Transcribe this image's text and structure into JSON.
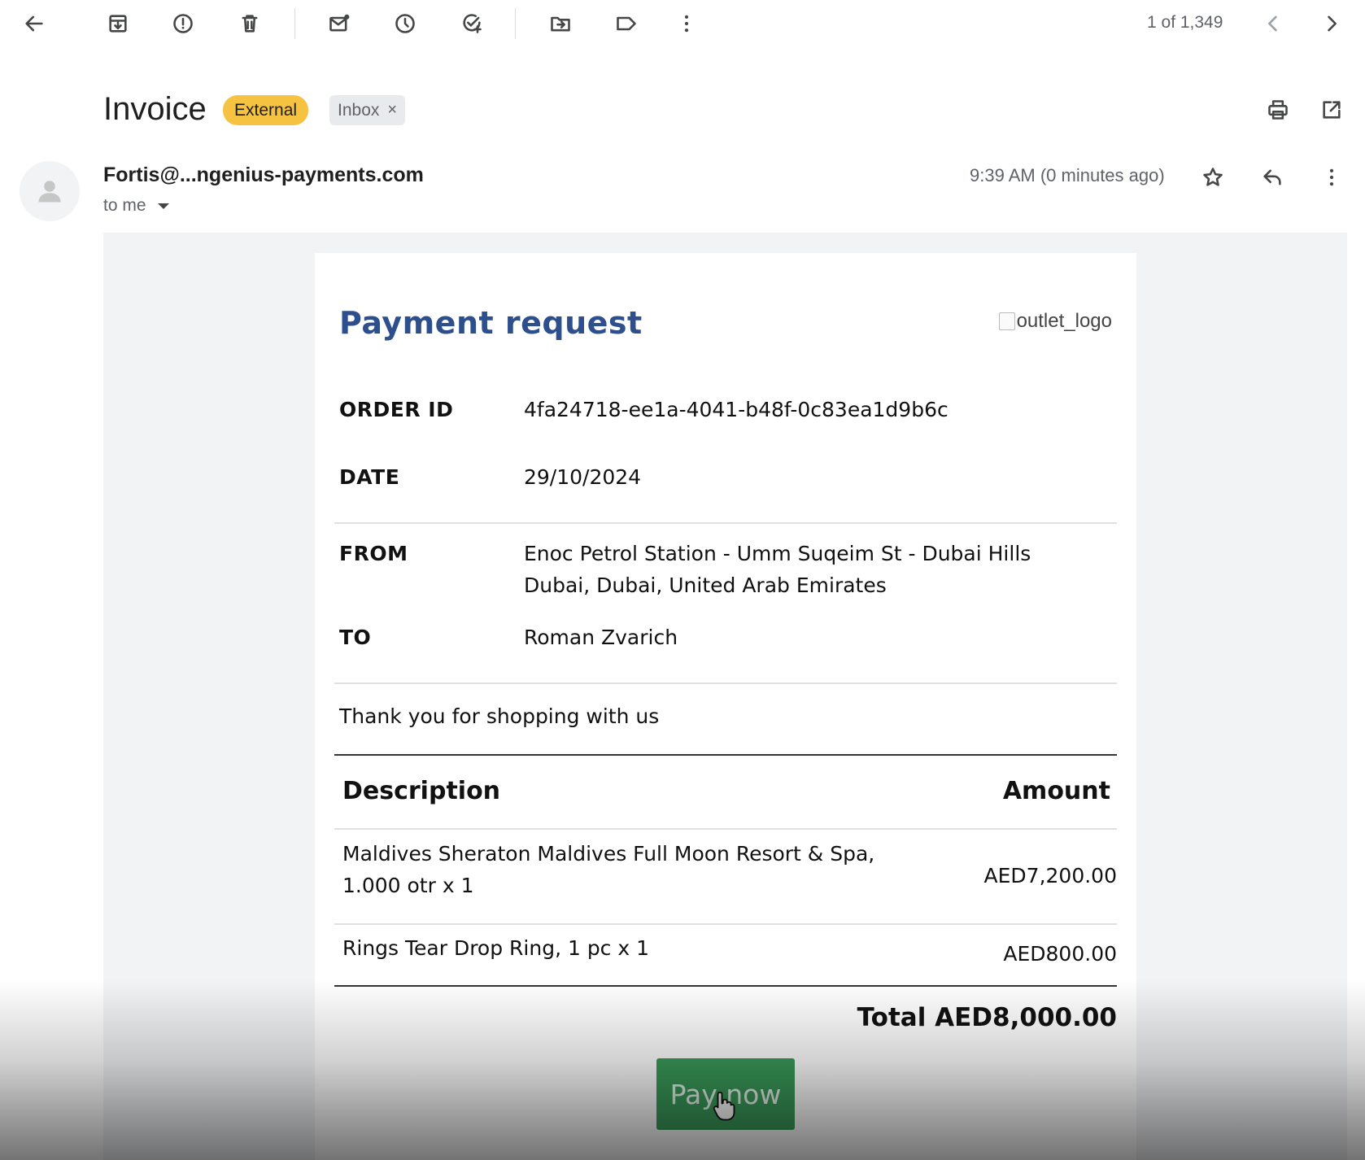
{
  "toolbar": {
    "icons": [
      "back-arrow-icon",
      "archive-icon",
      "report-spam-icon",
      "delete-icon",
      "mark-unread-icon",
      "snooze-icon",
      "add-task-icon",
      "move-to-icon",
      "label-icon",
      "more-vert-icon"
    ],
    "pager_text": "1 of 1,349"
  },
  "email": {
    "subject": "Invoice",
    "labels": {
      "external": "External",
      "inbox": "Inbox",
      "inbox_remove": "×"
    },
    "sender": "Fortis@...ngenius-payments.com",
    "recipient": "to me",
    "timestamp": "9:39 AM (0 minutes ago)"
  },
  "invoice": {
    "title": "Payment request",
    "logo_alt": "outlet_logo",
    "order_id_label": "ORDER ID",
    "order_id": "4fa24718-ee1a-4041-b48f-0c83ea1d9b6c",
    "date_label": "DATE",
    "date": "29/10/2024",
    "from_label": "FROM",
    "from_line1": "Enoc Petrol Station - Umm Suqeim St - Dubai Hills",
    "from_line2": "Dubai, Dubai, United Arab Emirates",
    "to_label": "TO",
    "to": "Roman Zvarich",
    "thank_you": "Thank you for shopping with us",
    "table": {
      "header_description": "Description",
      "header_amount": "Amount",
      "rows": [
        {
          "description_line1": "Maldives Sheraton Maldives Full Moon Resort & Spa,",
          "description_line2": "1.000 otr x 1",
          "amount": "AED7,200.00"
        },
        {
          "description_line1": "Rings Tear Drop Ring, 1 pc x 1",
          "amount": "AED800.00"
        }
      ]
    },
    "total": "Total AED8,000.00",
    "pay_button": "Pay now"
  },
  "colors": {
    "title_blue": "#2d4f8e",
    "external_chip": "#f5c242",
    "pay_green": "#3a9b5a"
  }
}
